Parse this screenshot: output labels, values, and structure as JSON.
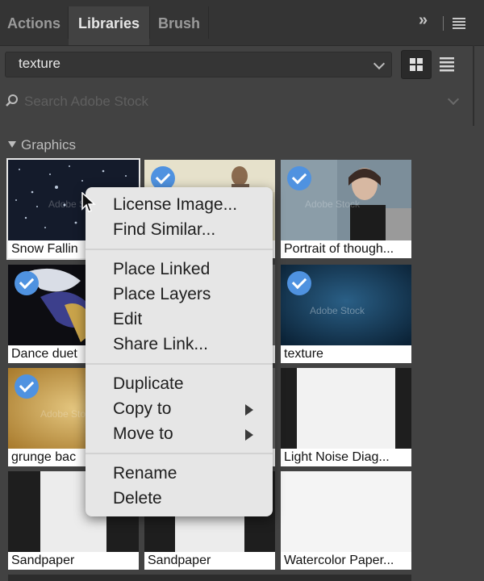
{
  "tabs": [
    {
      "label": "Actions",
      "active": false
    },
    {
      "label": "Libraries",
      "active": true
    },
    {
      "label": "Brush",
      "active": false
    }
  ],
  "library_select": {
    "value": "texture"
  },
  "search": {
    "placeholder": "Search Adobe Stock"
  },
  "group": {
    "label": "Graphics"
  },
  "tiles": [
    {
      "caption": "Snow Fallin",
      "checked": false,
      "selected": true
    },
    {
      "caption": "",
      "checked": true,
      "selected": false
    },
    {
      "caption": "Portrait of though...",
      "checked": true,
      "selected": false
    },
    {
      "caption": "Dance duet",
      "checked": true,
      "selected": false
    },
    {
      "caption": "",
      "checked": false,
      "selected": false
    },
    {
      "caption": "texture",
      "checked": true,
      "selected": false
    },
    {
      "caption": "grunge bac",
      "checked": true,
      "selected": false
    },
    {
      "caption": "",
      "checked": false,
      "selected": false
    },
    {
      "caption": "Light Noise Diag...",
      "checked": false,
      "selected": false
    },
    {
      "caption": "Sandpaper",
      "checked": false,
      "selected": false
    },
    {
      "caption": "Sandpaper",
      "checked": false,
      "selected": false
    },
    {
      "caption": "Watercolor Paper...",
      "checked": false,
      "selected": false
    }
  ],
  "context_menu": {
    "groups": [
      [
        "License Image...",
        "Find Similar..."
      ],
      [
        "Place Linked",
        "Place Layers",
        "Edit",
        "Share Link..."
      ],
      [
        "Duplicate",
        "Copy to",
        "Move to"
      ],
      [
        "Rename",
        "Delete"
      ]
    ]
  },
  "watermark": "Adobe Stock",
  "colors": {
    "accent": "#4f92e0",
    "panel": "#424242",
    "menu": "#e6e6e6"
  }
}
